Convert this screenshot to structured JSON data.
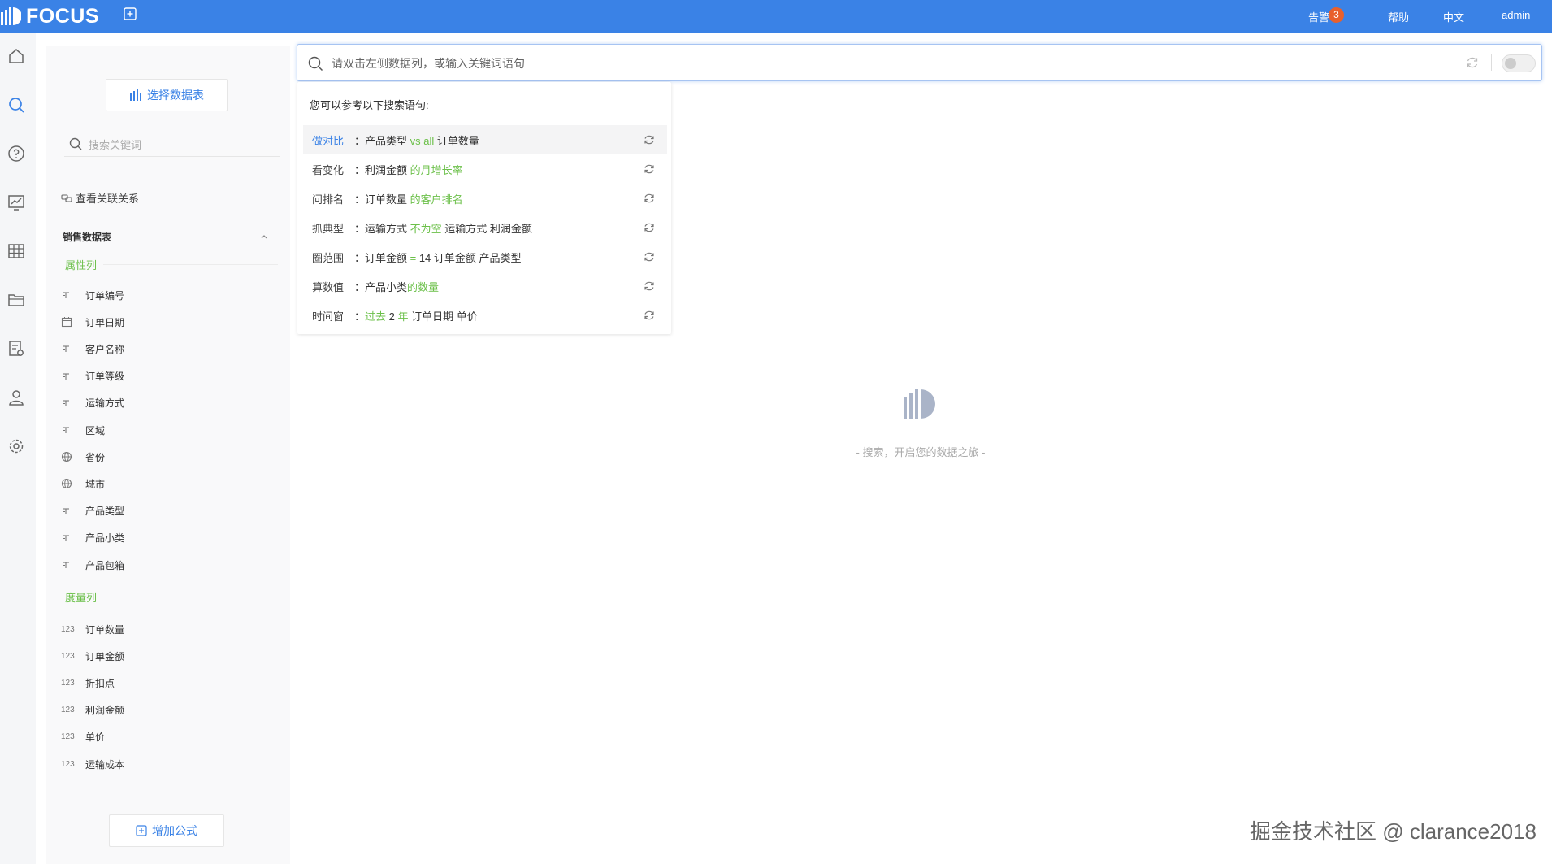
{
  "brand": {
    "name": "FOCUS",
    "color": "#3a82e6"
  },
  "topbar": {
    "alarm_label": "告警",
    "alarm_count": "3",
    "help_label": "帮助",
    "lang_label": "中文",
    "user_label": "admin"
  },
  "rail": {
    "icons": [
      "home-icon",
      "search-icon",
      "help-icon",
      "dashboard-icon",
      "table-icon",
      "folder-icon",
      "data-settings-icon",
      "user-icon",
      "gear-icon"
    ]
  },
  "panel": {
    "select_table_label": "选择数据表",
    "search_placeholder": "搜索关键词",
    "relation_link": "查看关联关系",
    "table_name": "销售数据表",
    "attribute_group": "属性列",
    "measure_group": "度量列",
    "attributes": [
      {
        "icon": "text",
        "label": "订单编号"
      },
      {
        "icon": "date",
        "label": "订单日期"
      },
      {
        "icon": "text",
        "label": "客户名称"
      },
      {
        "icon": "text",
        "label": "订单等级"
      },
      {
        "icon": "text",
        "label": "运输方式"
      },
      {
        "icon": "text",
        "label": "区域"
      },
      {
        "icon": "geo",
        "label": "省份"
      },
      {
        "icon": "geo",
        "label": "城市"
      },
      {
        "icon": "text",
        "label": "产品类型"
      },
      {
        "icon": "text",
        "label": "产品小类"
      },
      {
        "icon": "text",
        "label": "产品包箱"
      }
    ],
    "measures": [
      {
        "icon": "123",
        "label": "订单数量"
      },
      {
        "icon": "123",
        "label": "订单金额"
      },
      {
        "icon": "123",
        "label": "折扣点"
      },
      {
        "icon": "123",
        "label": "利润金额"
      },
      {
        "icon": "123",
        "label": "单价"
      },
      {
        "icon": "123",
        "label": "运输成本"
      }
    ],
    "add_formula_label": "增加公式"
  },
  "search": {
    "placeholder": "请双击左侧数据列，或输入关键词语句",
    "value": ""
  },
  "suggest": {
    "title": "您可以参考以下搜索语句:",
    "items": [
      {
        "label": "做对比",
        "parts": [
          {
            "t": "：产品类型 ",
            "g": false
          },
          {
            "t": "vs all",
            "g": true
          },
          {
            "t": " 订单数量",
            "g": false
          }
        ]
      },
      {
        "label": "看变化",
        "parts": [
          {
            "t": "：利润金额 ",
            "g": false
          },
          {
            "t": "的月增长率",
            "g": true
          }
        ]
      },
      {
        "label": "问排名",
        "parts": [
          {
            "t": "：订单数量 ",
            "g": false
          },
          {
            "t": "的客户排名",
            "g": true
          }
        ]
      },
      {
        "label": "抓典型",
        "parts": [
          {
            "t": "：运输方式 ",
            "g": false
          },
          {
            "t": "不为空",
            "g": true
          },
          {
            "t": " 运输方式 利润金额",
            "g": false
          }
        ]
      },
      {
        "label": "圈范围",
        "parts": [
          {
            "t": "：订单金额 ",
            "g": false
          },
          {
            "t": "=",
            "g": true
          },
          {
            "t": " 14 订单金额 产品类型",
            "g": false
          }
        ]
      },
      {
        "label": "算数值",
        "parts": [
          {
            "t": "：产品小类",
            "g": false
          },
          {
            "t": "的数量",
            "g": true
          }
        ]
      },
      {
        "label": "时间窗",
        "parts": [
          {
            "t": "：",
            "g": false
          },
          {
            "t": "过去",
            "g": true
          },
          {
            "t": " 2 ",
            "g": false
          },
          {
            "t": "年",
            "g": true
          },
          {
            "t": " 订单日期 单价",
            "g": false
          }
        ]
      }
    ]
  },
  "empty_state": {
    "text": "- 搜索，开启您的数据之旅 -"
  },
  "watermark": "掘金技术社区 @ clarance2018",
  "colors": {
    "accent": "#3a82e6",
    "keyword_green": "#6cc04a",
    "badge": "#e8602c"
  }
}
